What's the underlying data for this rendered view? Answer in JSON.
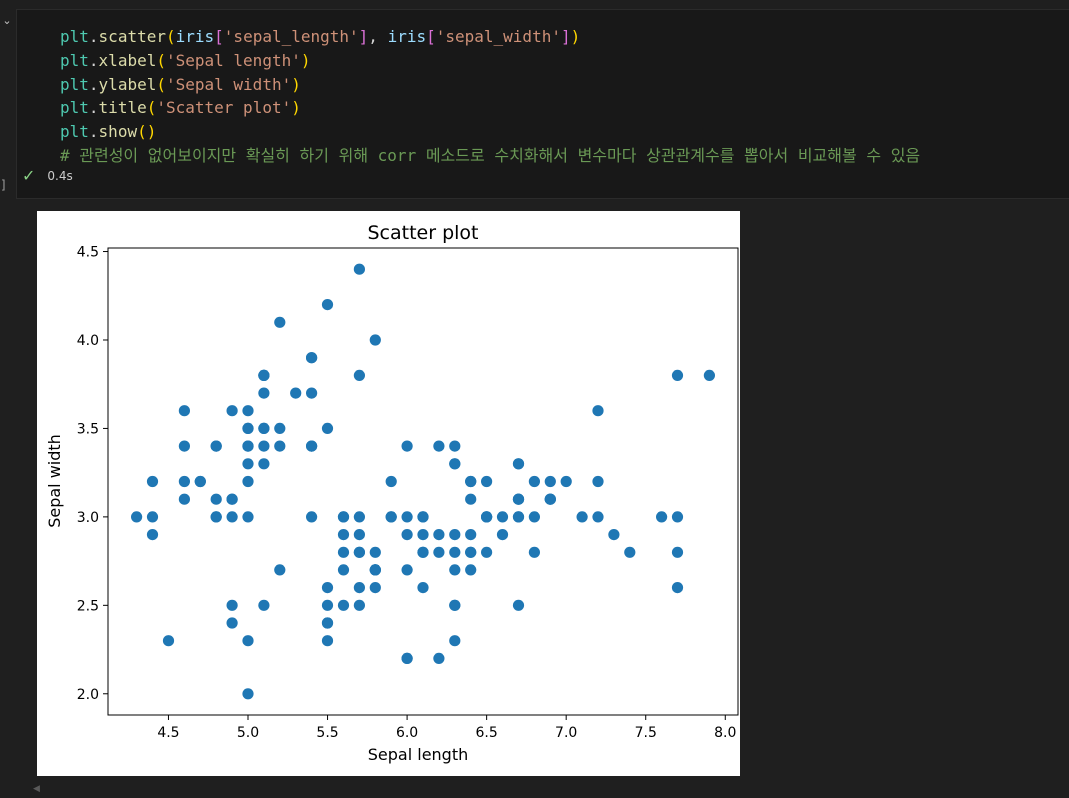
{
  "cell": {
    "execution_bracket": "]",
    "code_lines": [
      [
        [
          "tk-mod",
          "plt"
        ],
        [
          "tk-op",
          "."
        ],
        [
          "tk-fn",
          "scatter"
        ],
        [
          "tk-p1",
          "("
        ],
        [
          "tk-var",
          "iris"
        ],
        [
          "tk-p2",
          "["
        ],
        [
          "tk-str",
          "'sepal_length'"
        ],
        [
          "tk-p2",
          "]"
        ],
        [
          "tk-op",
          ", "
        ],
        [
          "tk-var",
          "iris"
        ],
        [
          "tk-p2",
          "["
        ],
        [
          "tk-str",
          "'sepal_width'"
        ],
        [
          "tk-p2",
          "]"
        ],
        [
          "tk-p1",
          ")"
        ]
      ],
      [
        [
          "tk-mod",
          "plt"
        ],
        [
          "tk-op",
          "."
        ],
        [
          "tk-fn",
          "xlabel"
        ],
        [
          "tk-p1",
          "("
        ],
        [
          "tk-str",
          "'Sepal length'"
        ],
        [
          "tk-p1",
          ")"
        ]
      ],
      [
        [
          "tk-mod",
          "plt"
        ],
        [
          "tk-op",
          "."
        ],
        [
          "tk-fn",
          "ylabel"
        ],
        [
          "tk-p1",
          "("
        ],
        [
          "tk-str",
          "'Sepal width'"
        ],
        [
          "tk-p1",
          ")"
        ]
      ],
      [
        [
          "tk-mod",
          "plt"
        ],
        [
          "tk-op",
          "."
        ],
        [
          "tk-fn",
          "title"
        ],
        [
          "tk-p1",
          "("
        ],
        [
          "tk-str",
          "'Scatter plot'"
        ],
        [
          "tk-p1",
          ")"
        ]
      ],
      [
        [
          "tk-mod",
          "plt"
        ],
        [
          "tk-op",
          "."
        ],
        [
          "tk-fn",
          "show"
        ],
        [
          "tk-p1",
          "()"
        ]
      ],
      [
        [
          "tk-cmt",
          "# 관련성이 없어보이지만 확실히 하기 위해 corr 메소드로 수치화해서 변수마다 상관관계수를 뽑아서 비교해볼 수 있음"
        ]
      ]
    ],
    "status_icon": "check-icon",
    "exec_time": "0.4s",
    "colors": {
      "success": "#89d185",
      "background": "#1f1f1f",
      "cell_bg": "#181818"
    }
  },
  "chart_data": {
    "type": "scatter",
    "title": "Scatter plot",
    "xlabel": "Sepal length",
    "ylabel": "Sepal width",
    "xlim": [
      4.12,
      8.08
    ],
    "ylim": [
      1.88,
      4.52
    ],
    "xticks": [
      "4.5",
      "5.0",
      "5.5",
      "6.0",
      "6.5",
      "7.0",
      "7.5",
      "8.0"
    ],
    "yticks": [
      "2.0",
      "2.5",
      "3.0",
      "3.5",
      "4.0",
      "4.5"
    ],
    "grid": false,
    "marker_color": "#1f77b4",
    "x": [
      5.1,
      4.9,
      4.7,
      4.6,
      5.0,
      5.4,
      4.6,
      5.0,
      4.4,
      4.9,
      5.4,
      4.8,
      4.8,
      4.3,
      5.8,
      5.7,
      5.4,
      5.1,
      5.7,
      5.1,
      5.4,
      5.1,
      4.6,
      5.1,
      4.8,
      5.0,
      5.0,
      5.2,
      5.2,
      4.7,
      4.8,
      5.4,
      5.2,
      5.5,
      4.9,
      5.0,
      5.5,
      4.9,
      4.4,
      5.1,
      5.0,
      4.5,
      4.4,
      5.0,
      5.1,
      4.8,
      5.1,
      4.6,
      5.3,
      5.0,
      7.0,
      6.4,
      6.9,
      5.5,
      6.5,
      5.7,
      6.3,
      4.9,
      6.6,
      5.2,
      5.0,
      5.9,
      6.0,
      6.1,
      5.6,
      6.7,
      5.6,
      5.8,
      6.2,
      5.6,
      5.9,
      6.1,
      6.3,
      6.1,
      6.4,
      6.6,
      6.8,
      6.7,
      6.0,
      5.7,
      5.5,
      5.5,
      5.8,
      6.0,
      5.4,
      6.0,
      6.7,
      6.3,
      5.6,
      5.5,
      5.5,
      6.1,
      5.8,
      5.0,
      5.6,
      5.7,
      5.7,
      6.2,
      5.1,
      5.7,
      6.3,
      5.8,
      7.1,
      6.3,
      6.5,
      7.6,
      4.9,
      7.3,
      6.7,
      7.2,
      6.5,
      6.4,
      6.8,
      5.7,
      5.8,
      6.4,
      6.5,
      7.7,
      7.7,
      6.0,
      6.9,
      5.6,
      7.7,
      6.3,
      6.7,
      7.2,
      6.2,
      6.1,
      6.4,
      7.2,
      7.4,
      7.9,
      6.4,
      6.3,
      6.1,
      7.7,
      6.3,
      6.4,
      6.0,
      6.9,
      6.7,
      6.9,
      5.8,
      6.8,
      6.7,
      6.7,
      6.3,
      6.5,
      6.2,
      5.9
    ],
    "y": [
      3.5,
      3.0,
      3.2,
      3.1,
      3.6,
      3.9,
      3.4,
      3.4,
      2.9,
      3.1,
      3.7,
      3.4,
      3.0,
      3.0,
      4.0,
      4.4,
      3.9,
      3.5,
      3.8,
      3.8,
      3.4,
      3.7,
      3.6,
      3.3,
      3.4,
      3.0,
      3.4,
      3.5,
      3.4,
      3.2,
      3.1,
      3.4,
      4.1,
      4.2,
      3.1,
      3.2,
      3.5,
      3.6,
      3.0,
      3.4,
      3.5,
      2.3,
      3.2,
      3.5,
      3.8,
      3.0,
      3.8,
      3.2,
      3.7,
      3.3,
      3.2,
      3.2,
      3.1,
      2.3,
      2.8,
      2.8,
      3.3,
      2.4,
      2.9,
      2.7,
      2.0,
      3.0,
      2.2,
      2.9,
      2.9,
      3.1,
      3.0,
      2.7,
      2.2,
      2.5,
      3.2,
      2.8,
      2.5,
      2.8,
      2.9,
      3.0,
      2.8,
      3.0,
      2.9,
      2.6,
      2.4,
      2.4,
      2.7,
      2.7,
      3.0,
      3.4,
      3.1,
      2.3,
      3.0,
      2.5,
      2.6,
      3.0,
      2.6,
      2.3,
      2.7,
      3.0,
      2.9,
      2.9,
      2.5,
      2.8,
      3.3,
      2.7,
      3.0,
      2.9,
      3.0,
      3.0,
      2.5,
      2.9,
      2.5,
      3.6,
      3.2,
      2.7,
      3.0,
      2.5,
      2.8,
      3.2,
      3.0,
      3.8,
      2.6,
      2.2,
      3.2,
      2.8,
      2.8,
      2.7,
      3.3,
      3.2,
      2.8,
      3.0,
      2.8,
      3.0,
      2.8,
      3.8,
      2.8,
      2.8,
      2.6,
      3.0,
      3.4,
      3.1,
      3.0,
      3.1,
      3.1,
      3.1,
      2.7,
      3.2,
      3.3,
      3.0,
      2.5,
      3.0,
      3.4,
      3.0
    ]
  }
}
